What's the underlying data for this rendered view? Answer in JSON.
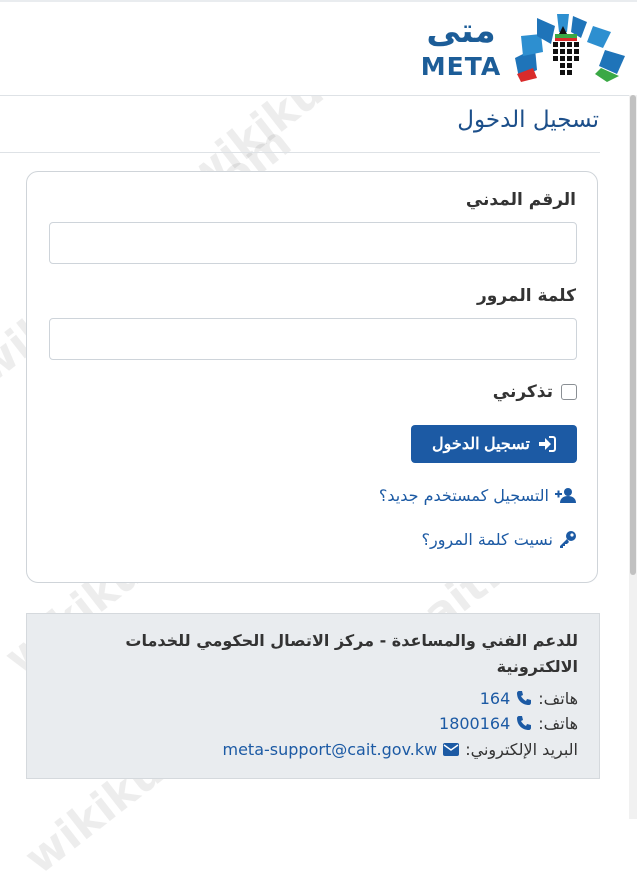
{
  "header": {
    "logo_ar": "متى",
    "logo_en": "META"
  },
  "page_title": "تسجيل الدخول",
  "form": {
    "civil_id_label": "الرقم المدني",
    "civil_id_value": "",
    "password_label": "كلمة المرور",
    "password_value": "",
    "remember_label": "تذكرني",
    "remember_checked": false,
    "login_button_label": "تسجيل الدخول",
    "register_link": "التسجيل كمستخدم جديد؟",
    "forgot_link": "نسيت كلمة المرور؟"
  },
  "support": {
    "title": "للدعم الفني والمساعدة - مركز الاتصال الحكومي للخدمات الالكترونية",
    "phone_label": "هاتف:",
    "phone_1": "164",
    "phone_2": "1800164",
    "email_label": "البريد الإلكتروني:",
    "email": "meta-support@cait.gov.kw"
  },
  "watermark_text": "wikikuwait.com",
  "colors": {
    "primary": "#1c5aa4",
    "title": "#1c4f8a",
    "support_bg": "#e9ecef"
  }
}
